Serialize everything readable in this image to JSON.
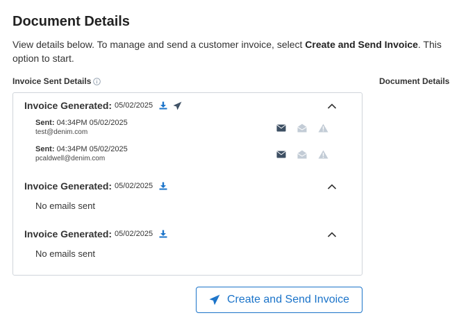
{
  "page": {
    "title": "Document Details",
    "intro_pre": "View details below. To manage and send a customer invoice, select ",
    "intro_bold": "Create and Send Invoice",
    "intro_post": ". This option to start."
  },
  "labels": {
    "invoice_sent_details": "Invoice Sent Details",
    "document_details": "Document Details"
  },
  "groups": [
    {
      "label": "Invoice Generated:",
      "date": "05/02/2025",
      "has_send_icon": true,
      "emails": [
        {
          "sent_label": "Sent:",
          "sent_time": "04:34PM 05/02/2025",
          "address": "test@denim.com"
        },
        {
          "sent_label": "Sent:",
          "sent_time": "04:34PM 05/02/2025",
          "address": "pcaldwell@denim.com"
        }
      ]
    },
    {
      "label": "Invoice Generated:",
      "date": "05/02/2025",
      "has_send_icon": false,
      "no_emails_text": "No emails sent"
    },
    {
      "label": "Invoice Generated:",
      "date": "05/02/2025",
      "has_send_icon": false,
      "no_emails_text": "No emails sent"
    }
  ],
  "cta": {
    "label": "Create and Send Invoice"
  },
  "colors": {
    "accent": "#1a73c9",
    "icon_dark": "#3d4f63",
    "icon_muted": "#c3ccd6",
    "border": "#cfd4da"
  },
  "icons": {
    "info": "info-circle-icon",
    "download": "download-icon",
    "send": "paper-plane-icon",
    "collapse": "chevron-up-icon",
    "delivered": "envelope-closed-icon",
    "opened": "envelope-open-icon",
    "error": "warning-triangle-icon"
  }
}
